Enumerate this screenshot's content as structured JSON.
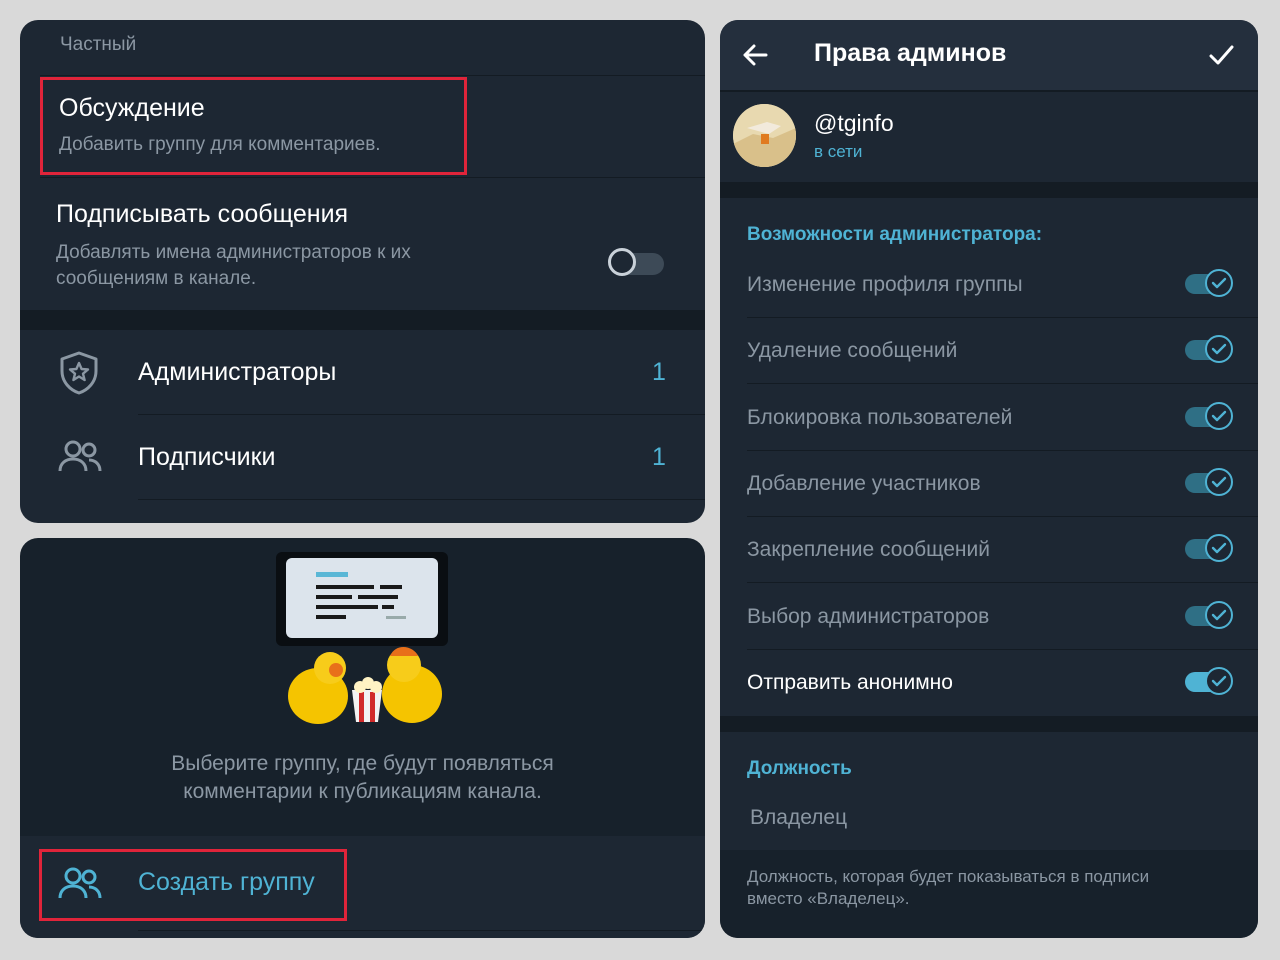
{
  "left_top": {
    "type_label": "Частный",
    "discussion_title": "Обсуждение",
    "discussion_sub": "Добавить группу для комментариев.",
    "sign_title": "Подписывать сообщения",
    "sign_sub_1": "Добавлять имена администраторов к их",
    "sign_sub_2": "сообщениям в канале.",
    "admins_label": "Администраторы",
    "admins_count": "1",
    "subs_label": "Подписчики",
    "subs_count": "1"
  },
  "left_bottom": {
    "desc_1": "Выберите группу, где будут появляться",
    "desc_2": "комментарии к публикациям канала.",
    "create_group": "Создать группу"
  },
  "right": {
    "title": "Права админов",
    "user_name": "@tginfo",
    "user_status": "в сети",
    "section_caps": "Возможности администратора:",
    "perms": [
      "Изменение профиля группы",
      "Удаление сообщений",
      "Блокировка пользователей",
      "Добавление участников",
      "Закрепление сообщений",
      "Выбор администраторов",
      "Отправить анонимно"
    ],
    "section_role": "Должность",
    "role_placeholder": "Владелец",
    "role_hint_1": "Должность, которая будет показываться в подписи",
    "role_hint_2": "вместо «Владелец»."
  },
  "colors": {
    "accent": "#4fb3d4",
    "highlight": "#e0243a",
    "panel": "#1d2733"
  }
}
